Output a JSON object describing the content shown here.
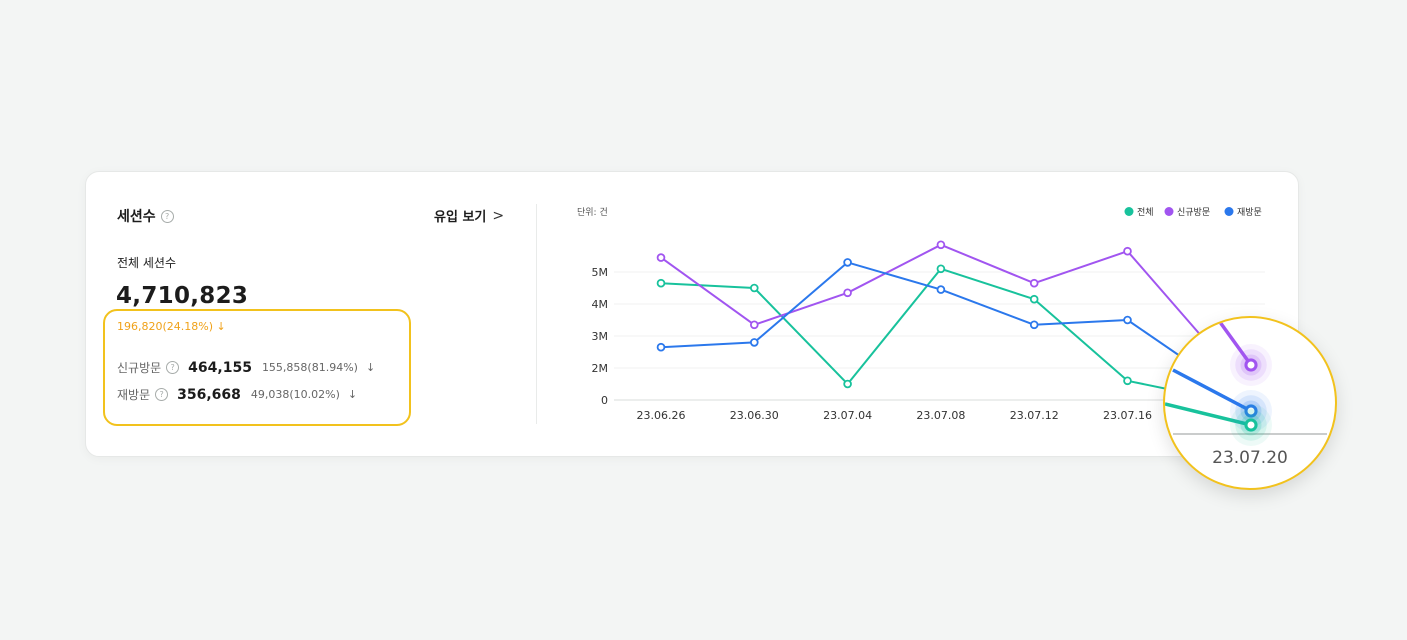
{
  "summary": {
    "title": "세션수",
    "help_icon": "question-circle-icon",
    "inflow_link": "유입 보기",
    "total_label": "전체 세션수",
    "total_value": "4,710,823",
    "total_change": "196,820(24.18%)",
    "down_arrow": "↓",
    "new_visit": {
      "label": "신규방문",
      "value": "464,155",
      "change": "155,858(81.94%)"
    },
    "revisit": {
      "label": "재방문",
      "value": "356,668",
      "change": "49,038(10.02%)"
    }
  },
  "colors": {
    "total": "#18c29c",
    "new": "#a155f0",
    "revisit": "#2b78ec",
    "change": "#f0a21a",
    "highlight": "#f2c21d"
  },
  "chart_data": {
    "type": "line",
    "unit_label": "단위: 건",
    "categories": [
      "23.06.26",
      "23.06.30",
      "23.07.04",
      "23.07.08",
      "23.07.12",
      "23.07.16",
      "23.07.20"
    ],
    "series": [
      {
        "name": "전체",
        "color": "#18c29c",
        "values": [
          3.65,
          3.5,
          0.5,
          4.1,
          3.15,
          0.6,
          0.0
        ]
      },
      {
        "name": "신규방문",
        "color": "#a155f0",
        "values": [
          4.45,
          2.35,
          3.35,
          4.85,
          3.65,
          4.65,
          1.3
        ]
      },
      {
        "name": "재방문",
        "color": "#2b78ec",
        "values": [
          1.65,
          1.8,
          4.3,
          3.45,
          2.35,
          2.5,
          0.5
        ]
      }
    ],
    "y_ticks": [
      "0",
      "2M",
      "3M",
      "4M",
      "5M"
    ],
    "y_tick_values": [
      0,
      1,
      2,
      3,
      4
    ],
    "ylim": [
      0,
      5
    ],
    "legend_position": "top-right",
    "grid": true
  },
  "magnifier": {
    "label": "23.07.20"
  }
}
